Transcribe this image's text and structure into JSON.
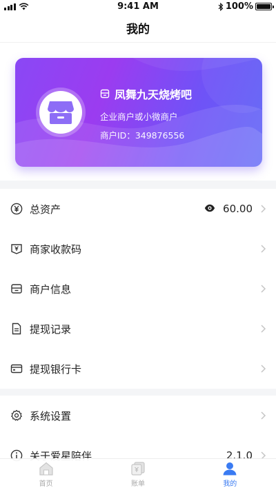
{
  "status_bar": {
    "time": "9:41 AM",
    "battery": "100%",
    "battery_level": 1.0
  },
  "header": {
    "title": "我的"
  },
  "merchant_card": {
    "name": "凤舞九天烧烤吧",
    "type": "企业商户或小微商户",
    "id_label": "商户ID：",
    "id_value": "349876556"
  },
  "menu": {
    "items": [
      {
        "label": "总资产",
        "icon": "yen-circle-icon",
        "value": "60.00"
      },
      {
        "label": "商家收款码",
        "icon": "payment-code-icon"
      },
      {
        "label": "商户信息",
        "icon": "store-info-icon"
      },
      {
        "label": "提现记录",
        "icon": "document-icon"
      },
      {
        "label": "提现银行卡",
        "icon": "bank-card-icon"
      }
    ],
    "settings": [
      {
        "label": "系统设置",
        "icon": "gear-icon"
      },
      {
        "label": "关于爱星陪伴",
        "icon": "info-icon",
        "value": "2.1.0"
      }
    ]
  },
  "tab_bar": {
    "tabs": [
      {
        "label": "首页",
        "icon": "home-icon"
      },
      {
        "label": "账单",
        "icon": "bill-icon"
      },
      {
        "label": "我的",
        "icon": "profile-icon"
      }
    ],
    "active_index": 2
  },
  "colors": {
    "accent": "#3a7bf2",
    "card_gradient_start": "#8a48f5",
    "card_gradient_end": "#5e64f6"
  }
}
